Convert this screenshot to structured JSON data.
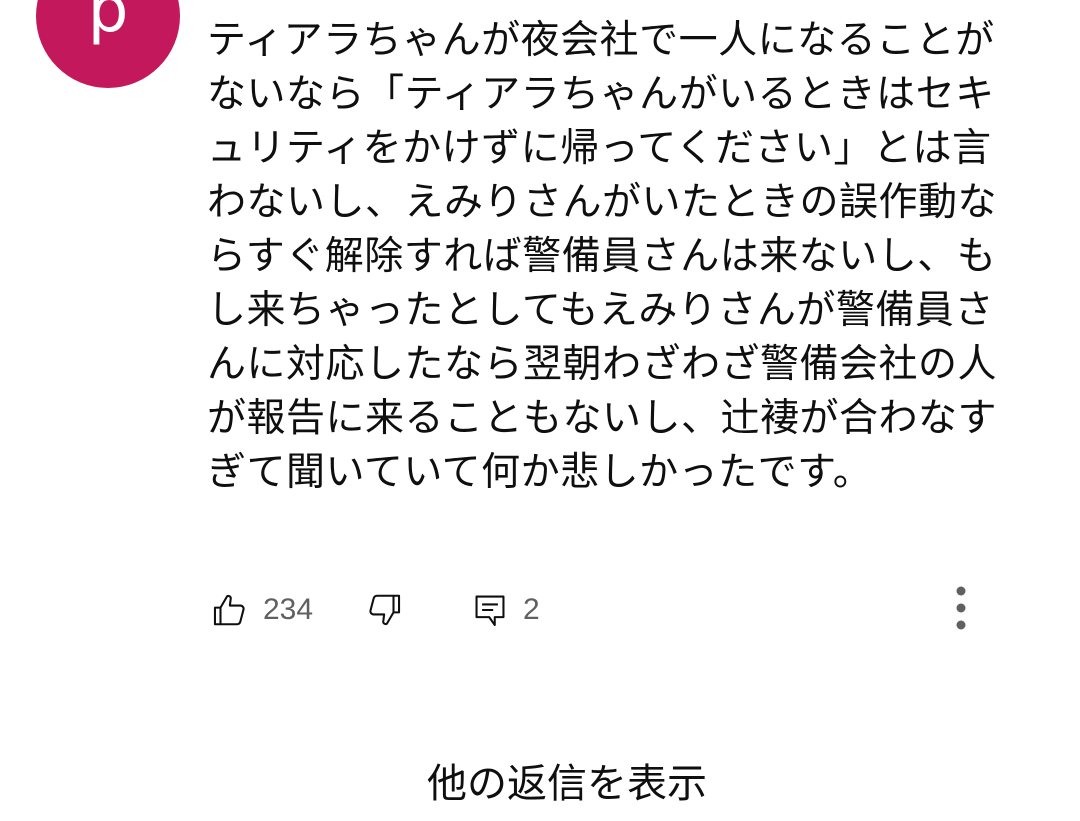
{
  "comment": {
    "avatar_letter": "p",
    "avatar_color": "#c4185c",
    "text": "ティアラちゃんが夜会社で一人になることがないなら「ティアラちゃんがいるときはセキュリティをかけずに帰ってください」とは言わないし、えみりさんがいたときの誤作動ならすぐ解除すれば警備員さんは来ないし、もし来ちゃったとしてもえみりさんが警備員さんに対応したなら翌朝わざわざ警備会社の人が報告に来ることもないし、辻褄が合わなすぎて聞いていて何か悲しかったです。",
    "like_count": "234",
    "reply_count": "2"
  },
  "icons": {
    "like": "thumbs-up-icon",
    "dislike": "thumbs-down-icon",
    "reply": "comment-icon",
    "more": "more-vertical-icon"
  },
  "show_replies_label": "他の返信を表示"
}
